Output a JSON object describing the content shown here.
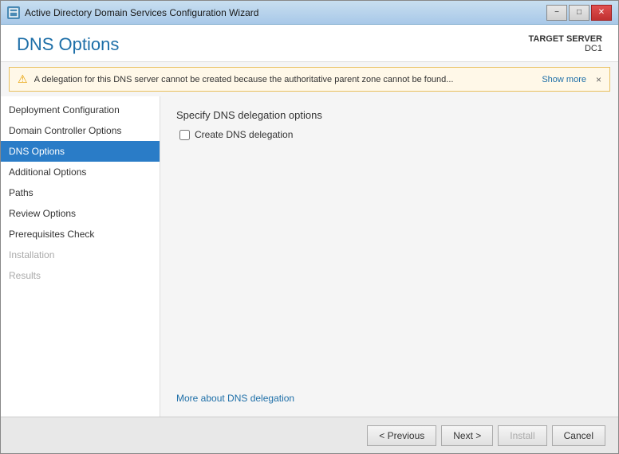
{
  "window": {
    "title": "Active Directory Domain Services Configuration Wizard",
    "icon": "AD"
  },
  "title_bar_controls": {
    "minimize": "−",
    "maximize": "□",
    "close": "✕"
  },
  "header": {
    "page_title": "DNS Options",
    "target_server_label": "TARGET SERVER",
    "target_server_name": "DC1"
  },
  "warning": {
    "text": "A delegation for this DNS server cannot be created because the authoritative parent zone cannot be found...",
    "show_more": "Show more",
    "close": "×"
  },
  "sidebar": {
    "items": [
      {
        "label": "Deployment Configuration",
        "state": "normal"
      },
      {
        "label": "Domain Controller Options",
        "state": "normal"
      },
      {
        "label": "DNS Options",
        "state": "active"
      },
      {
        "label": "Additional Options",
        "state": "normal"
      },
      {
        "label": "Paths",
        "state": "normal"
      },
      {
        "label": "Review Options",
        "state": "normal"
      },
      {
        "label": "Prerequisites Check",
        "state": "normal"
      },
      {
        "label": "Installation",
        "state": "disabled"
      },
      {
        "label": "Results",
        "state": "disabled"
      }
    ]
  },
  "main": {
    "section_title": "Specify DNS delegation options",
    "checkbox_label": "Create DNS delegation",
    "info_link": "More about DNS delegation"
  },
  "footer": {
    "previous_label": "< Previous",
    "next_label": "Next >",
    "install_label": "Install",
    "cancel_label": "Cancel"
  }
}
